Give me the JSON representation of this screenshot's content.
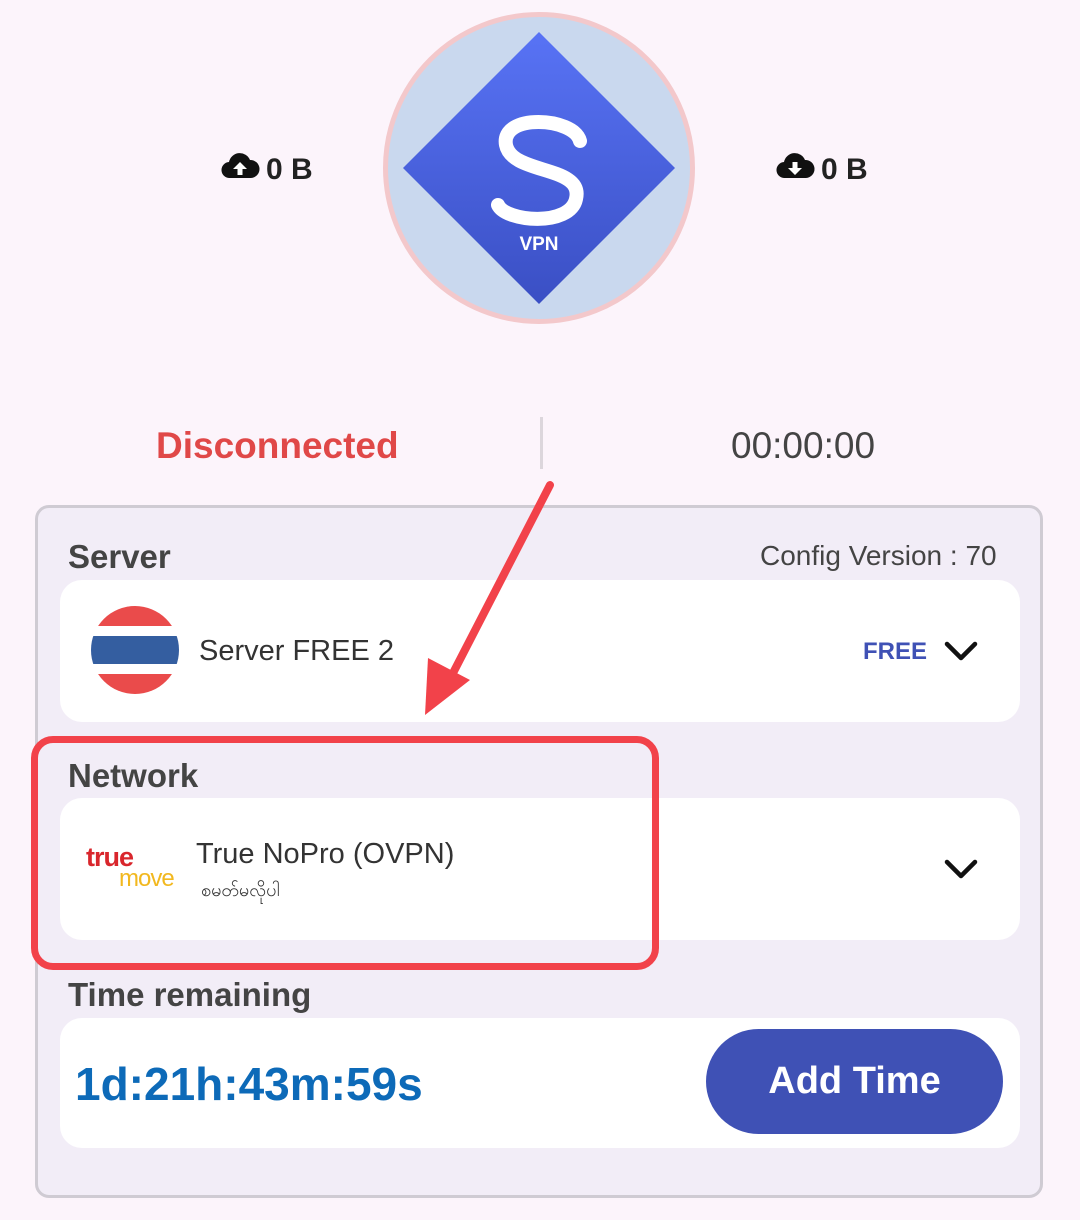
{
  "stats": {
    "upload": "0 B",
    "download": "0 B",
    "upload_icon": "cloud-upload-icon",
    "download_icon": "cloud-download-icon"
  },
  "connect_button": {
    "logo_text": "VPN",
    "logo_icon": "s-vpn-logo"
  },
  "status": {
    "state": "Disconnected",
    "timer": "00:00:00"
  },
  "server": {
    "section_label": "Server",
    "config_version": "Config Version : 70",
    "name": "Server FREE 2",
    "badge": "FREE",
    "flag_icon": "thailand-flag-icon"
  },
  "network": {
    "section_label": "Network",
    "name": "True NoPro (OVPN)",
    "subtitle": "စမတ်မလိုပါ",
    "logo_line1": "true",
    "logo_line2": "move"
  },
  "time": {
    "section_label": "Time remaining",
    "remaining": "1d:21h:43m:59s",
    "add_button": "Add Time"
  },
  "colors": {
    "accent": "#3f51b5",
    "disconnected": "#e04848",
    "annotation": "#f2424a",
    "time_value": "#0d6ab8",
    "free_badge": "#3f51b5"
  }
}
